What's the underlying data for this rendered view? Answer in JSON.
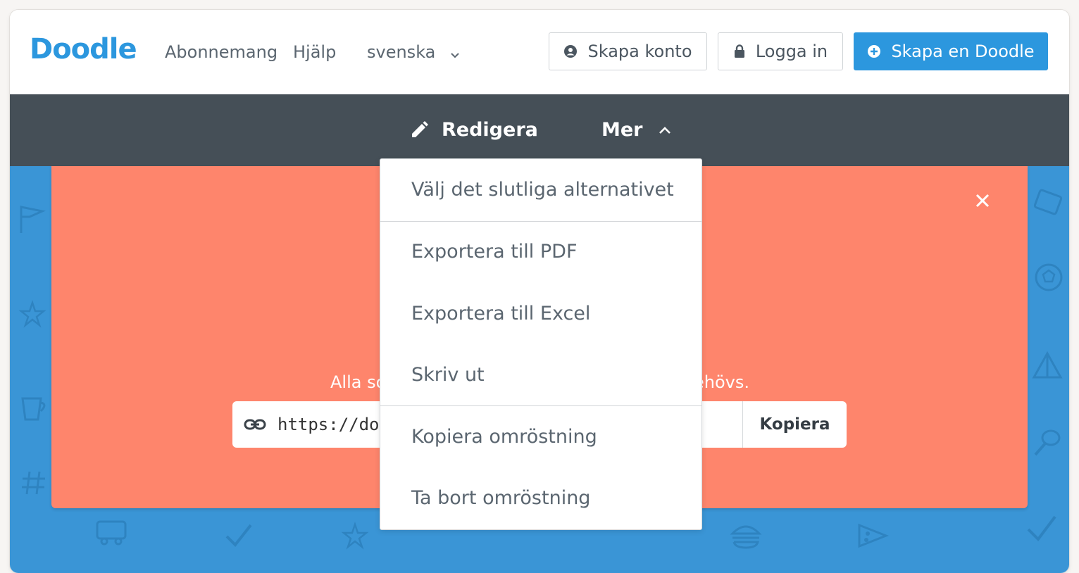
{
  "header": {
    "logo": "Doodle",
    "nav": [
      "Abonnemang",
      "Hjälp"
    ],
    "language": "svenska",
    "create_account": "Skapa konto",
    "login": "Logga in",
    "create_doodle": "Skapa en Doodle"
  },
  "toolbar": {
    "edit": "Redigera",
    "more": "Mer"
  },
  "card": {
    "info_left": "Alla so",
    "info_right": "ehövs.",
    "link_value": "https://doo",
    "copy_label": "Kopiera"
  },
  "dropdown": {
    "items": [
      "Välj det slutliga alternativet",
      "Exportera till PDF",
      "Exportera till Excel",
      "Skriv ut",
      "Kopiera omröstning",
      "Ta bort omröstning"
    ]
  },
  "colors": {
    "brand": "#2c97de",
    "toolbar": "#454f57",
    "card": "#fe856c",
    "background_pattern": "#3a95d6"
  }
}
